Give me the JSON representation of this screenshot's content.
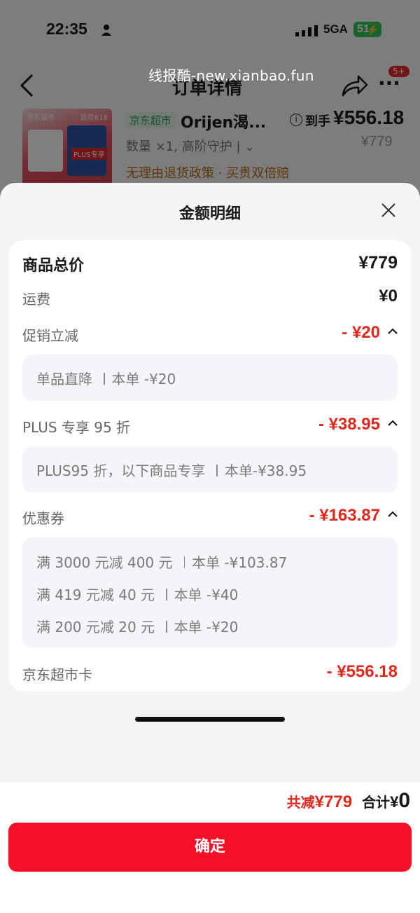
{
  "status": {
    "time": "22:35",
    "network": "5GA",
    "battery": "51"
  },
  "watermark": "线报酷-new.xianbao.fun",
  "nav": {
    "title": "订单详情",
    "badge": "5+"
  },
  "product": {
    "shop_tag": "京东超市",
    "name": "Orijen渴...",
    "daoshou_label": "到手",
    "daoshou_price": "¥556.18",
    "original_price": "¥779",
    "quantity": "数量 ×1, 高阶守护 | ⌄",
    "policy": "无理由退货政策 · 买贵双倍赔",
    "thumb_brand": "京东超市",
    "thumb_promo": "狂欢618",
    "thumb_plus": "PLUS专享"
  },
  "sheet": {
    "title": "金额明细",
    "total_goods_label": "商品总价",
    "total_goods_value": "¥779",
    "shipping_label": "运费",
    "shipping_value": "¥0",
    "promo": {
      "label": "促销立减",
      "value": "- ¥20",
      "details": [
        {
          "text": "单品直降",
          "amount": "本单 -¥20"
        }
      ]
    },
    "plus": {
      "label": "PLUS 专享 95 折",
      "value": "- ¥38.95",
      "details": [
        {
          "text": "PLUS95 折，以下商品专享",
          "amount": "本单-¥38.95"
        }
      ]
    },
    "coupon": {
      "label": "优惠券",
      "value": "- ¥163.87",
      "details": [
        {
          "text": "满 3000 元减 400 元",
          "amount": "本单 -¥103.87"
        },
        {
          "text": "满 419 元减 40 元",
          "amount": "本单 -¥40"
        },
        {
          "text": "满 200 元减 20 元",
          "amount": "本单 -¥20"
        }
      ]
    },
    "card": {
      "label": "京东超市卡",
      "value": "- ¥556.18"
    }
  },
  "footer": {
    "discount_label": "共减",
    "discount_value": "¥779",
    "total_label": "合计",
    "total_currency": "¥",
    "total_value": "0",
    "confirm": "确定"
  },
  "colors": {
    "accent_red": "#e0281e",
    "button_red": "#f5102a",
    "shop_green": "#29a15a"
  }
}
